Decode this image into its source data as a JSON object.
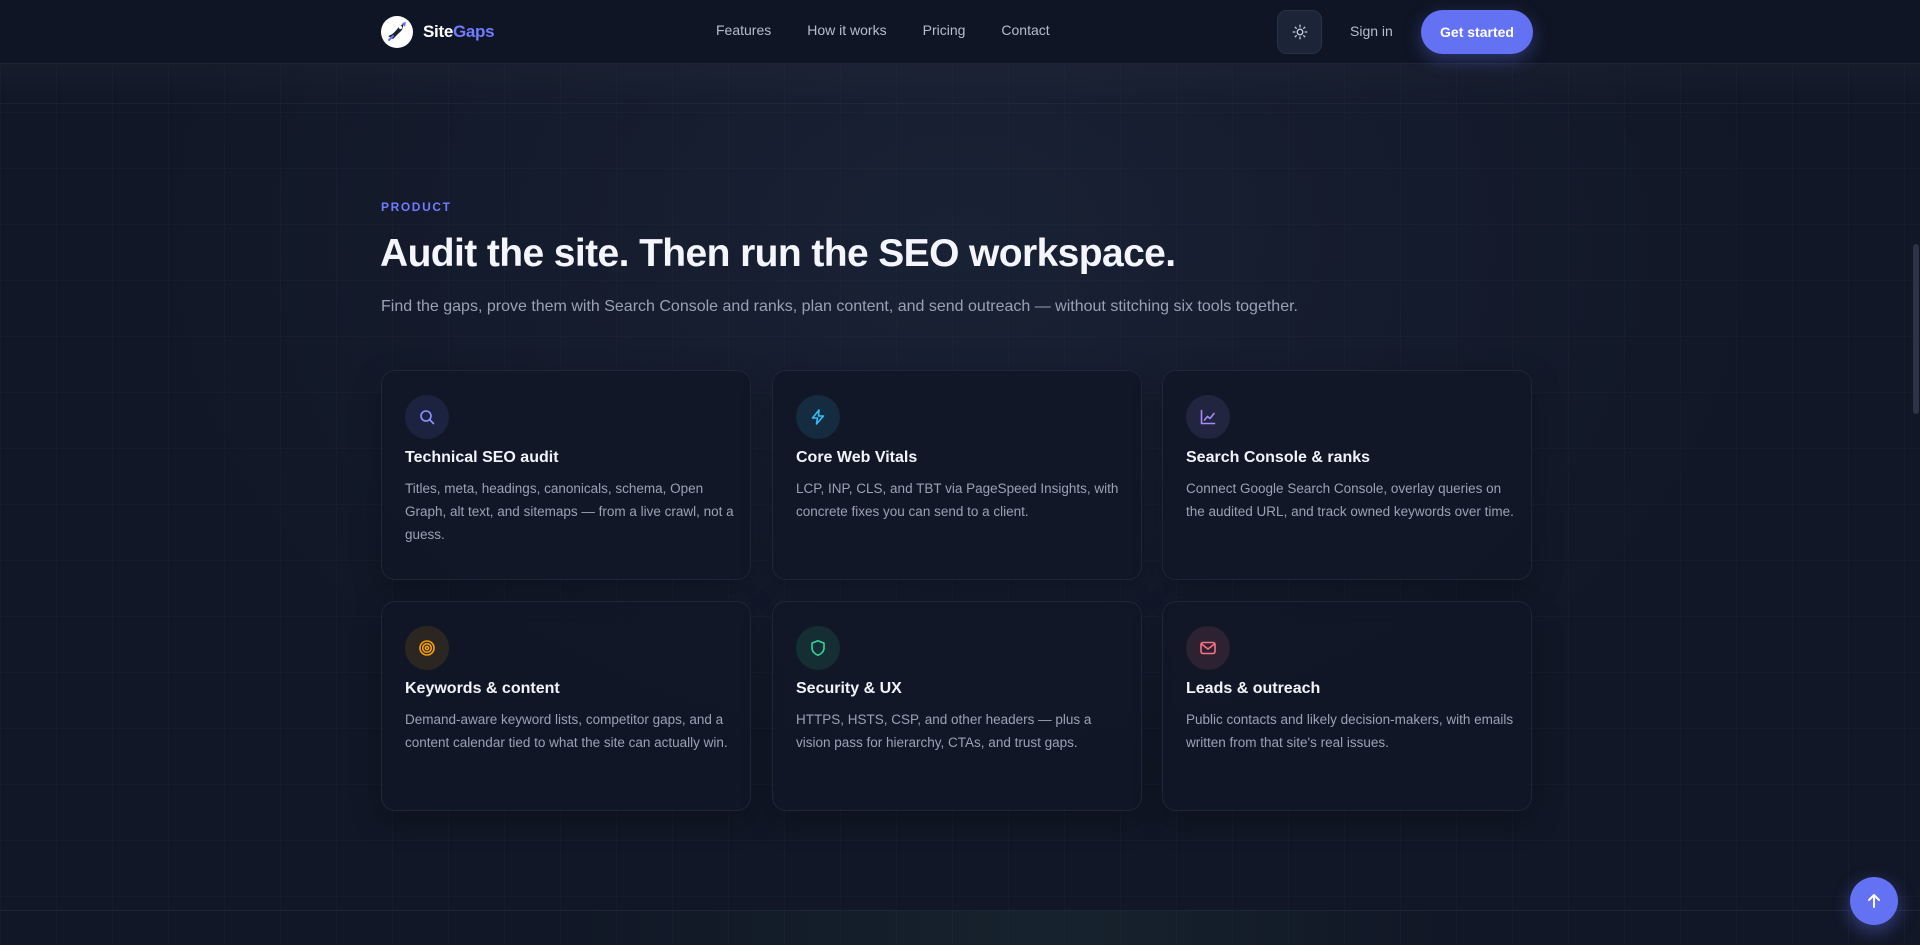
{
  "header": {
    "brand": {
      "part1": "Site",
      "part2": "Gaps"
    },
    "nav": [
      "Features",
      "How it works",
      "Pricing",
      "Contact"
    ],
    "theme_icon": "sun-icon",
    "signin_label": "Sign in",
    "cta_label": "Get started"
  },
  "hero": {
    "eyebrow": "PRODUCT",
    "title": "Audit the site. Then run the SEO workspace.",
    "subtitle": "Find the gaps, prove them with Search Console and ranks, plan content, and send outreach — without stitching six tools together."
  },
  "features": [
    {
      "icon": "search-icon",
      "accent": "#8f93ff",
      "title": "Technical SEO audit",
      "desc": "Titles, meta, headings, canonicals, schema, Open Graph, alt text, and sitemaps — from a live crawl, not a guess."
    },
    {
      "icon": "bolt-icon",
      "accent": "#38bdf8",
      "title": "Core Web Vitals",
      "desc": "LCP, INP, CLS, and TBT via PageSpeed Insights, with concrete fixes you can send to a client."
    },
    {
      "icon": "chart-icon",
      "accent": "#a78bfa",
      "title": "Search Console & ranks",
      "desc": "Connect Google Search Console, overlay queries on the audited URL, and track owned keywords over time."
    },
    {
      "icon": "target-icon",
      "accent": "#f59e0b",
      "title": "Keywords & content",
      "desc": "Demand-aware keyword lists, competitor gaps, and a content calendar tied to what the site can actually win."
    },
    {
      "icon": "shield-icon",
      "accent": "#34d399",
      "title": "Security & UX",
      "desc": "HTTPS, HSTS, CSP, and other headers — plus a vision pass for hierarchy, CTAs, and trust gaps."
    },
    {
      "icon": "mail-icon",
      "accent": "#fb7185",
      "title": "Leads & outreach",
      "desc": "Public contacts and likely decision-makers, with emails written from that site's real issues."
    }
  ],
  "scroll_top_icon": "arrow-up-icon"
}
